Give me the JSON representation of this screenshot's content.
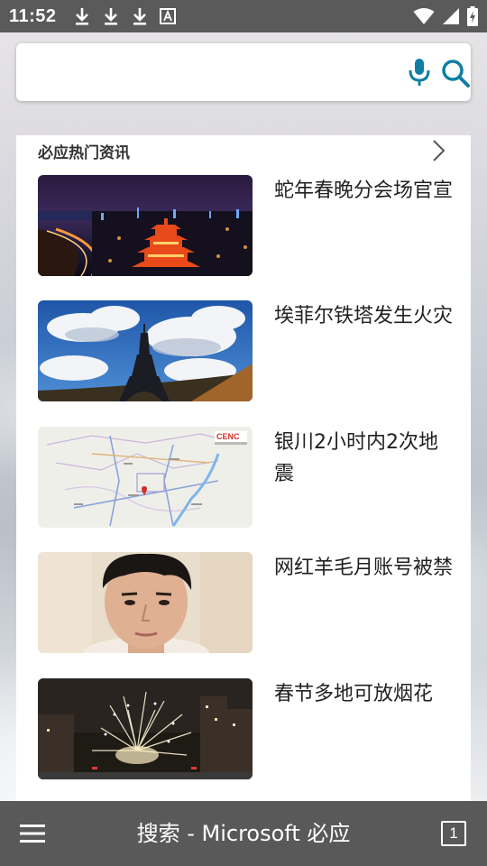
{
  "status_bar": {
    "time": "11:52",
    "left_icons": [
      "download-icon",
      "download-icon",
      "download-icon",
      "text-a-icon"
    ],
    "right_icons": [
      "wifi-icon",
      "signal-icon",
      "battery-charging-icon"
    ]
  },
  "search": {
    "value": "",
    "placeholder": ""
  },
  "news": {
    "section_title": "必应热门资讯",
    "items": [
      {
        "title": "蛇年春晚分会场官宣",
        "thumb": "night-city-pagoda"
      },
      {
        "title": "埃菲尔铁塔发生火灾",
        "thumb": "eiffel-tower-sky"
      },
      {
        "title": "银川2小时内2次地震",
        "thumb": "map"
      },
      {
        "title": "网红羊毛月账号被禁",
        "thumb": "portrait"
      },
      {
        "title": "春节多地可放烟花",
        "thumb": "fireworks"
      }
    ]
  },
  "bottom_bar": {
    "title": "搜索 - Microsoft 必应",
    "tab_count": "1"
  },
  "colors": {
    "accent": "#0f7fa3",
    "status_bar_bg": "#5a5a5a",
    "bottom_bar_bg": "#595959"
  }
}
